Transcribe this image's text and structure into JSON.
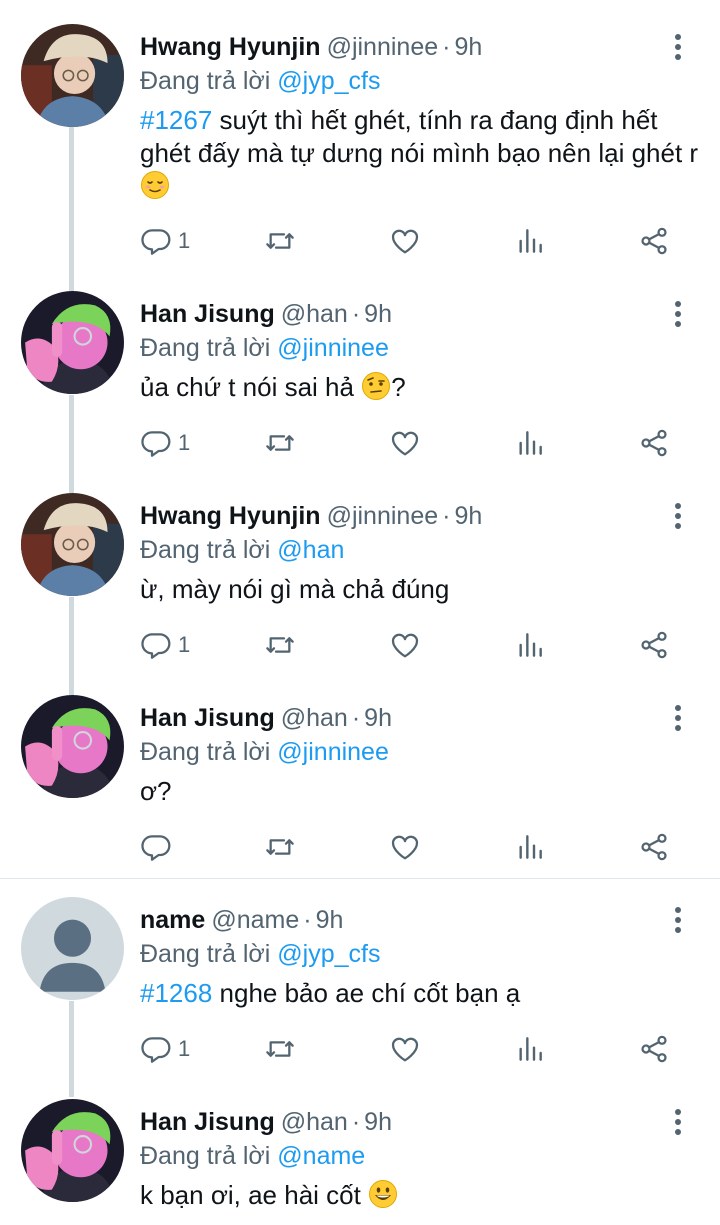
{
  "colors": {
    "link": "#1d9bf0",
    "muted": "#536471",
    "text": "#0f1419",
    "thread": "#cfd9de"
  },
  "reply_prefix": "Đang trả lời",
  "tweets": [
    {
      "name": "Hwang Hyunjin",
      "handle": "@jinninee",
      "dot": "·",
      "time": "9h",
      "reply_to": "@jyp_cfs",
      "hashtag": "#1267",
      "text": " suýt thì hết ghét, tính ra đang định hết ghét đấy mà tự dưng nói mình bạo nên lại ghét r",
      "emoji": "relieved-face",
      "reply_count": "1",
      "avatar": "hyunjin-avatar"
    },
    {
      "name": "Han Jisung",
      "handle": "@han",
      "dot": "·",
      "time": "9h",
      "reply_to": "@jinninee",
      "text": "ủa chứ t nói sai hả",
      "emoji": "raised-eyebrow-face",
      "text_after": "?",
      "reply_count": "1",
      "avatar": "jisung-avatar"
    },
    {
      "name": "Hwang Hyunjin",
      "handle": "@jinninee",
      "dot": "·",
      "time": "9h",
      "reply_to": "@han",
      "text": "ừ, mày nói gì mà chả đúng",
      "reply_count": "1",
      "avatar": "hyunjin-avatar"
    },
    {
      "name": "Han Jisung",
      "handle": "@han",
      "dot": "·",
      "time": "9h",
      "reply_to": "@jinninee",
      "text": "ơ?",
      "reply_count": "",
      "avatar": "jisung-avatar"
    },
    {
      "name": "name",
      "handle": "@name",
      "dot": "·",
      "time": "9h",
      "reply_to": "@jyp_cfs",
      "hashtag": "#1268",
      "text": " nghe bảo ae chí cốt bạn ạ",
      "reply_count": "1",
      "avatar": "default-avatar"
    },
    {
      "name": "Han Jisung",
      "handle": "@han",
      "dot": "·",
      "time": "9h",
      "reply_to": "@name",
      "text": "k bạn ơi, ae hài cốt",
      "emoji": "grinning-face",
      "reply_count": "",
      "avatar": "jisung-avatar"
    }
  ]
}
